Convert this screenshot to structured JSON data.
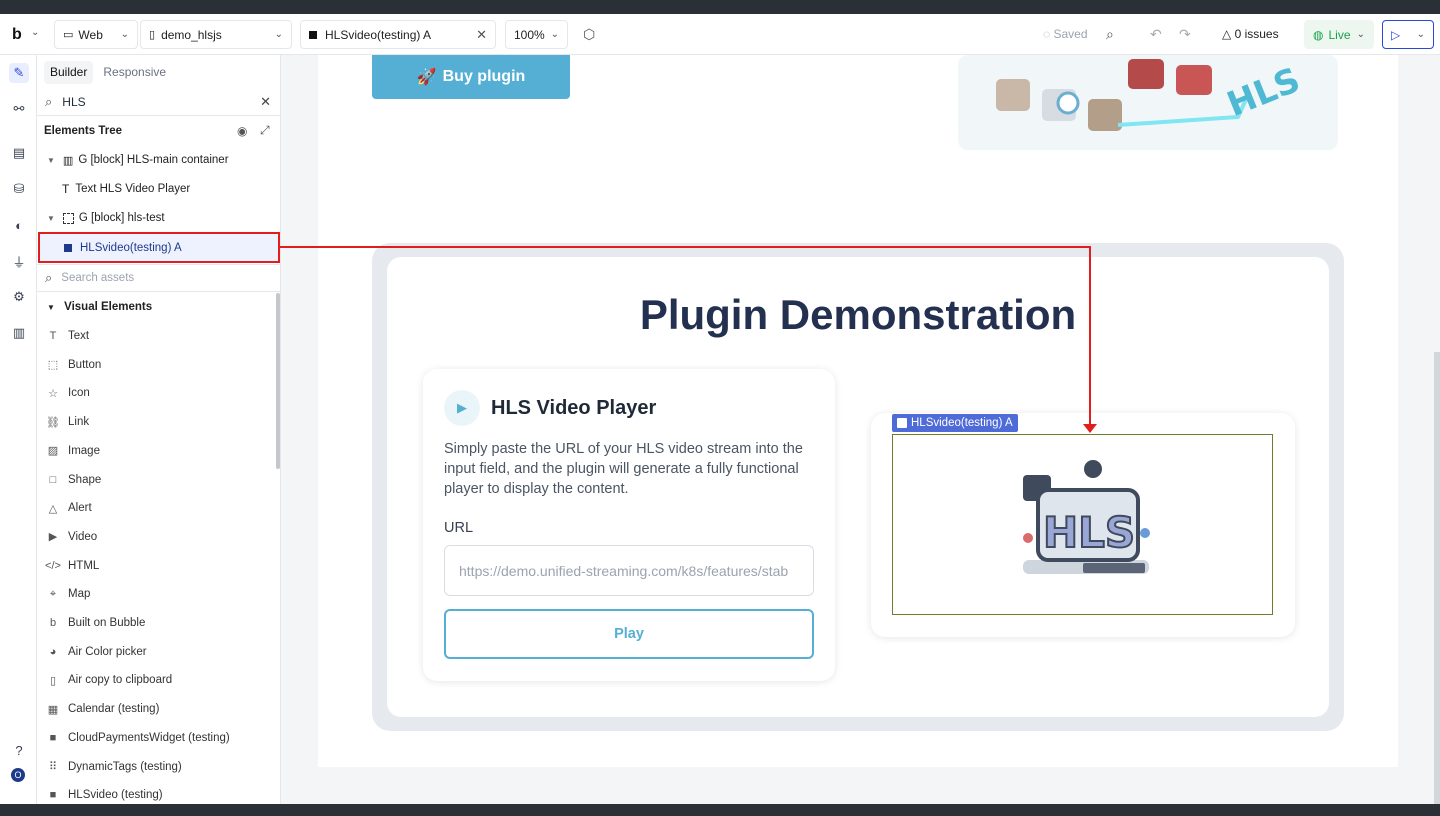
{
  "topbar": {
    "logo": "b",
    "platform": "Web",
    "app_name": "demo_hlsjs",
    "element_tab": "HLSvideo(testing) A",
    "zoom": "100%",
    "saved": "Saved",
    "issues": "0 issues",
    "live": "Live"
  },
  "panel": {
    "tabs": [
      "Builder",
      "Responsive"
    ],
    "search_value": "HLS",
    "tree_title": "Elements Tree",
    "tree": [
      {
        "label": "G [block] HLS-main container"
      },
      {
        "label": "Text HLS Video Player"
      },
      {
        "label": "G [block] hls-test"
      },
      {
        "label": "HLSvideo(testing) A"
      }
    ],
    "assets_placeholder": "Search assets",
    "section": "Visual Elements",
    "elements": [
      {
        "label": "Text",
        "icon": "text-icon"
      },
      {
        "label": "Button",
        "icon": "button-icon"
      },
      {
        "label": "Icon",
        "icon": "star-icon"
      },
      {
        "label": "Link",
        "icon": "link-icon"
      },
      {
        "label": "Image",
        "icon": "image-icon"
      },
      {
        "label": "Shape",
        "icon": "square-icon"
      },
      {
        "label": "Alert",
        "icon": "alert-icon"
      },
      {
        "label": "Video",
        "icon": "video-icon"
      },
      {
        "label": "HTML",
        "icon": "code-icon"
      },
      {
        "label": "Map",
        "icon": "map-pin-icon"
      },
      {
        "label": "Built on Bubble",
        "icon": "bubble-icon"
      },
      {
        "label": "Air Color picker",
        "icon": "palette-icon"
      },
      {
        "label": "Air copy to clipboard",
        "icon": "clipboard-icon"
      },
      {
        "label": "Calendar (testing)",
        "icon": "calendar-icon"
      },
      {
        "label": "CloudPaymentsWidget (testing)",
        "icon": "plugin-square-icon"
      },
      {
        "label": "DynamicTags (testing)",
        "icon": "grid-icon"
      },
      {
        "label": "HLSvideo (testing)",
        "icon": "plugin-square-icon"
      }
    ]
  },
  "canvas": {
    "buy_button": "Buy plugin",
    "demo_title": "Plugin Demonstration",
    "card_title": "HLS Video Player",
    "card_desc": "Simply paste the URL of your HLS video stream into the input field, and the plugin will generate a fully functional player to display the content.",
    "url_label": "URL",
    "url_value": "https://demo.unified-streaming.com/k8s/features/stab",
    "play_label": "Play",
    "video_tag": "HLSvideo(testing) A",
    "hls_logo_text": "HLS"
  },
  "colors": {
    "accent": "#55afd4",
    "title": "#24304f",
    "highlight": "#e11d1d",
    "selection": "#4f6bd8"
  }
}
